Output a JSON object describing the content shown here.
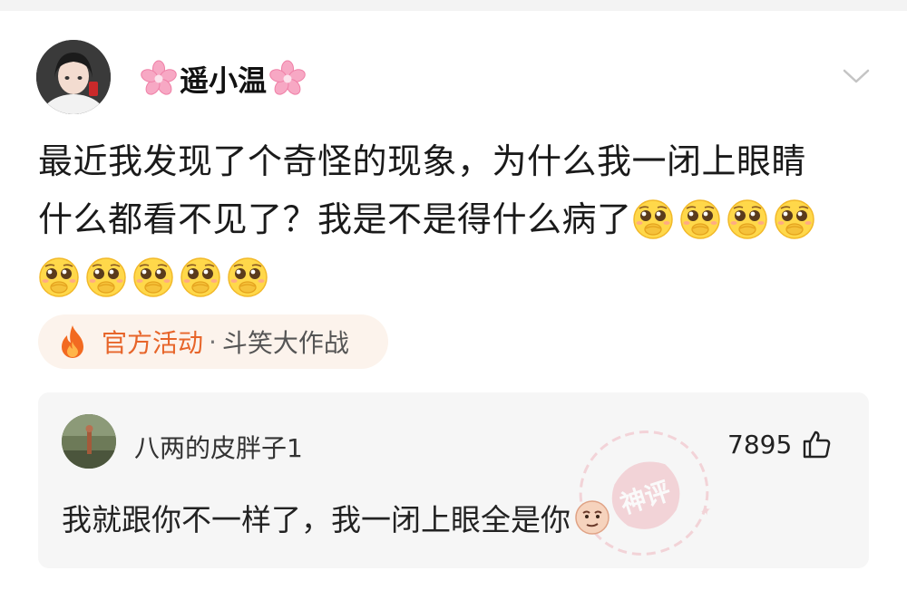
{
  "post": {
    "username": "遥小温",
    "text_line1": "最近我发现了个奇怪的现象，为什么我一闭上眼睛",
    "text_line2": "什么都看不见了？我是不是得什么病了",
    "emoji_name": "pleading-face-emoji",
    "emoji_count_line2": 4,
    "emoji_count_line3": 5
  },
  "activity": {
    "official_label": "官方活动",
    "dot": "·",
    "name": "斗笑大作战"
  },
  "comment": {
    "username": "八两的皮胖子1",
    "likes": "7895",
    "text": "我就跟你不一样了，我一闭上眼全是你",
    "stamp_text": "神评"
  },
  "colors": {
    "accent": "#e7652a",
    "chip_bg": "#fcf3ec",
    "comment_bg": "#f6f6f6",
    "stamp": "#f0b7bf"
  },
  "icons": [
    "sakura-icon",
    "chevron-down-icon",
    "flame-icon",
    "thumbs-up-icon",
    "smug-face-emoji",
    "god-comment-stamp"
  ]
}
